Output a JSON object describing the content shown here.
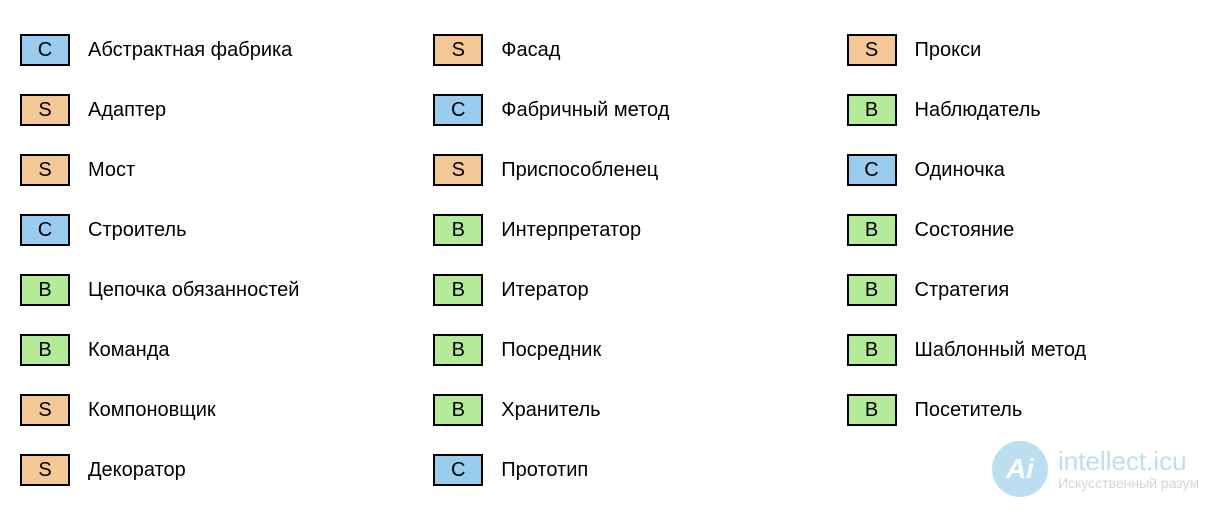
{
  "badge_colors": {
    "C": "#99ccee",
    "S": "#f4c896",
    "B": "#b4eb99"
  },
  "columns": [
    [
      {
        "type": "C",
        "label": "Абстрактная фабрика"
      },
      {
        "type": "S",
        "label": "Адаптер"
      },
      {
        "type": "S",
        "label": "Мост"
      },
      {
        "type": "C",
        "label": "Строитель"
      },
      {
        "type": "B",
        "label": "Цепочка обязанностей"
      },
      {
        "type": "B",
        "label": "Команда"
      },
      {
        "type": "S",
        "label": "Компоновщик"
      },
      {
        "type": "S",
        "label": "Декоратор"
      }
    ],
    [
      {
        "type": "S",
        "label": "Фасад"
      },
      {
        "type": "C",
        "label": "Фабричный метод"
      },
      {
        "type": "S",
        "label": "Приспособленец"
      },
      {
        "type": "B",
        "label": "Интерпретатор"
      },
      {
        "type": "B",
        "label": "Итератор"
      },
      {
        "type": "B",
        "label": "Посредник"
      },
      {
        "type": "B",
        "label": "Хранитель"
      },
      {
        "type": "C",
        "label": "Прототип"
      }
    ],
    [
      {
        "type": "S",
        "label": "Прокси"
      },
      {
        "type": "B",
        "label": "Наблюдатель"
      },
      {
        "type": "C",
        "label": "Одиночка"
      },
      {
        "type": "B",
        "label": "Состояние"
      },
      {
        "type": "B",
        "label": "Стратегия"
      },
      {
        "type": "B",
        "label": "Шаблонный метод"
      },
      {
        "type": "B",
        "label": "Посетитель"
      }
    ]
  ],
  "watermark": {
    "icon_letter": "Ai",
    "title": "intellect.icu",
    "subtitle": "Искусственный разум"
  }
}
